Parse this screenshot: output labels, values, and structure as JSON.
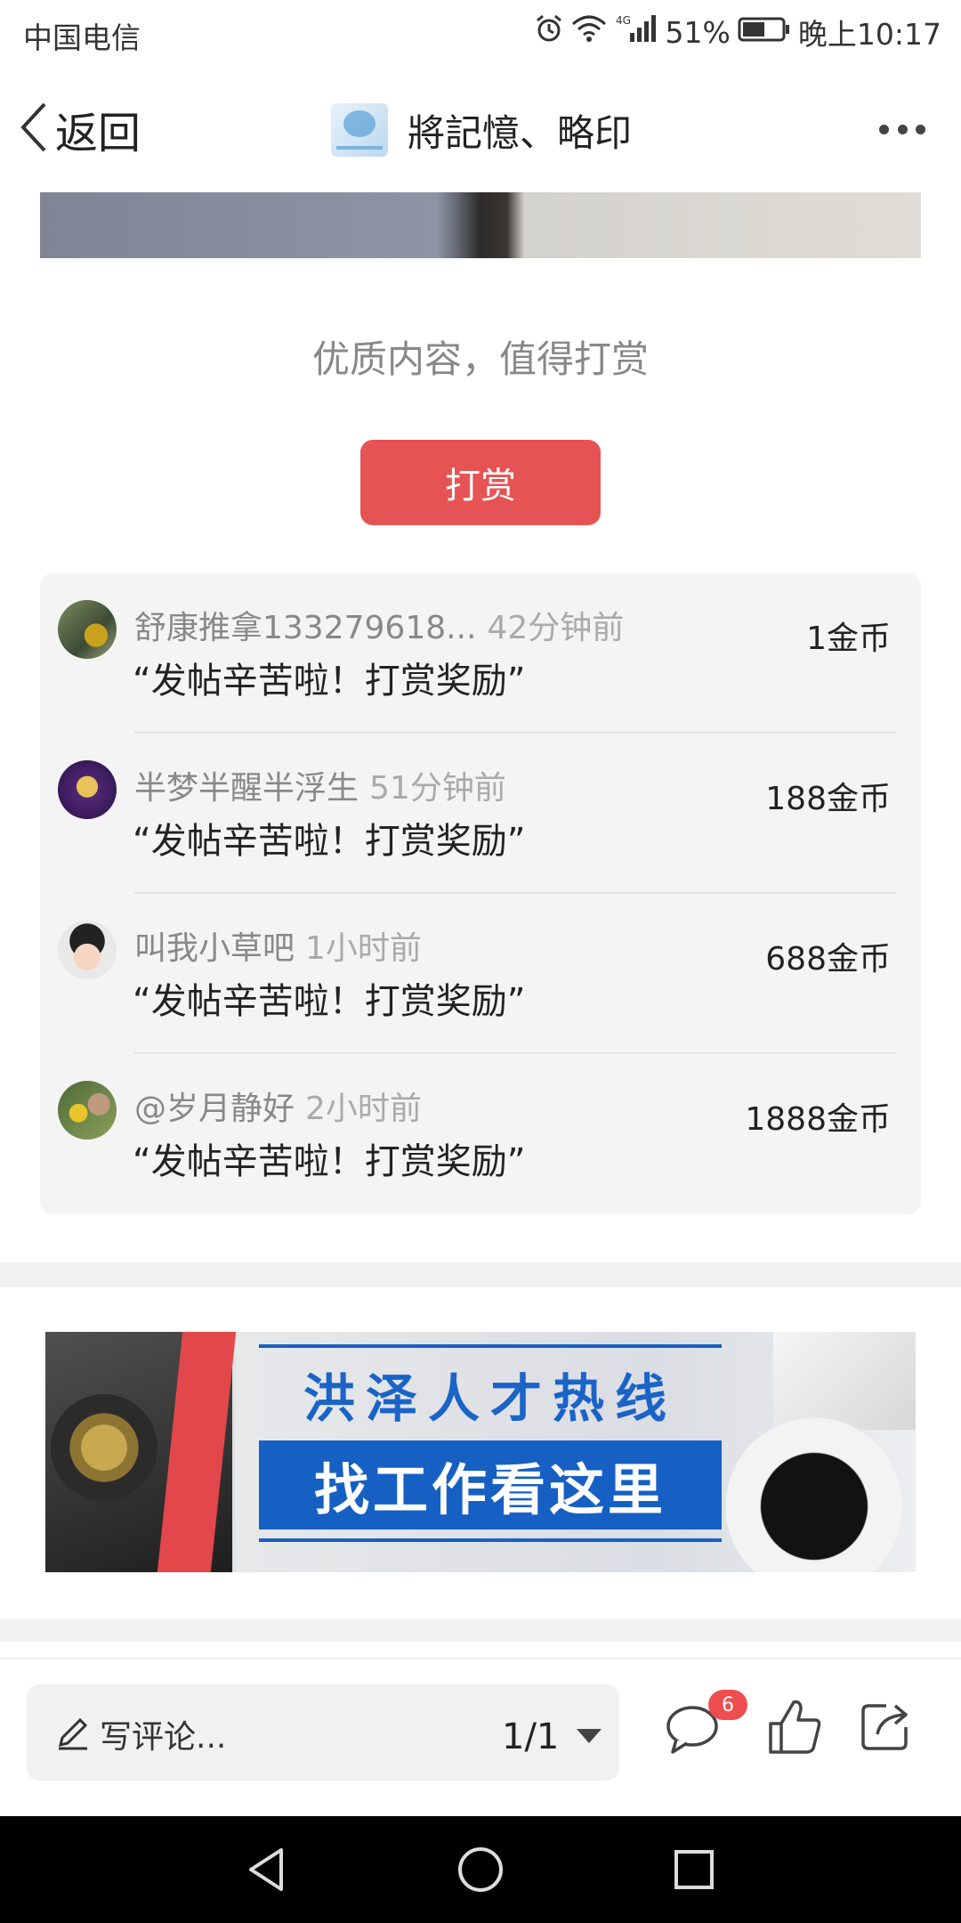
{
  "status_bar": {
    "carrier": "中国电信",
    "network": "4G",
    "battery": "51%",
    "time": "晚上10:17"
  },
  "nav": {
    "back_label": "返回",
    "title": "將記憶、略印",
    "more_icon": "more-horizontal-icon"
  },
  "reward": {
    "prompt": "优质内容，值得打赏",
    "button_label": "打赏",
    "button_color": "#e65354",
    "items": [
      {
        "name": "舒康推拿133279618...",
        "time": "42分钟前",
        "message": "“发帖辛苦啦！打赏奖励”",
        "amount": "1金币"
      },
      {
        "name": "半梦半醒半浮生",
        "time": "51分钟前",
        "message": "“发帖辛苦啦！打赏奖励”",
        "amount": "188金币"
      },
      {
        "name": "叫我小草吧",
        "time": "1小时前",
        "message": "“发帖辛苦啦！打赏奖励”",
        "amount": "688金币"
      },
      {
        "name": "@岁月静好",
        "time": "2小时前",
        "message": "“发帖辛苦啦！打赏奖励”",
        "amount": "1888金币"
      }
    ]
  },
  "ad": {
    "title": "洪泽人才热线",
    "subtitle": "找工作看这里",
    "accent_color": "#1660c4"
  },
  "action_bar": {
    "comment_placeholder": "写评论...",
    "page_indicator": "1/1",
    "comment_count": "6"
  }
}
